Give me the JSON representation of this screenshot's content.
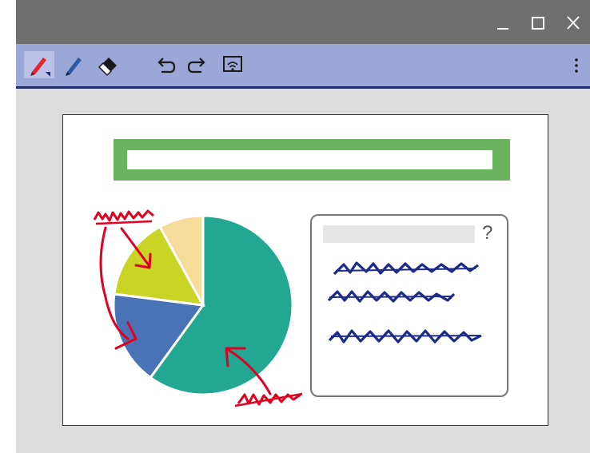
{
  "window": {
    "controls": {
      "minimize_icon": "minimize-icon",
      "maximize_icon": "maximize-icon",
      "close_icon": "close-icon"
    }
  },
  "toolbar": {
    "tools": [
      {
        "name": "red-pen",
        "icon": "red-pen-icon",
        "selected": true,
        "color": "#e3242b"
      },
      {
        "name": "blue-pen",
        "icon": "blue-pen-icon",
        "selected": false,
        "color": "#2b5aa6"
      },
      {
        "name": "eraser",
        "icon": "eraser-icon",
        "selected": false
      },
      {
        "name": "undo",
        "icon": "undo-icon",
        "selected": false
      },
      {
        "name": "redo",
        "icon": "redo-icon",
        "selected": false
      },
      {
        "name": "screen-share",
        "icon": "cast-icon",
        "selected": false
      }
    ],
    "more_icon": "more-vertical-icon"
  },
  "slide": {
    "title_placeholder": "",
    "card": {
      "question_mark": "?"
    }
  },
  "chart_data": {
    "type": "pie",
    "title": "",
    "slices": [
      {
        "value": 60,
        "color": "#22a892"
      },
      {
        "value": 17,
        "color": "#4a72b6"
      },
      {
        "value": 15,
        "color": "#c9d424"
      },
      {
        "value": 8,
        "color": "#f5dc9a"
      }
    ]
  },
  "colors": {
    "titlebar": "#6f6f6f",
    "toolbar": "#9ba7d6",
    "toolbar_border": "#1d2b66",
    "canvas_bg": "#dcdcdc",
    "title_box": "#6ab35f",
    "annotation_red": "#e00022",
    "annotation_blue": "#1c2a8a"
  }
}
